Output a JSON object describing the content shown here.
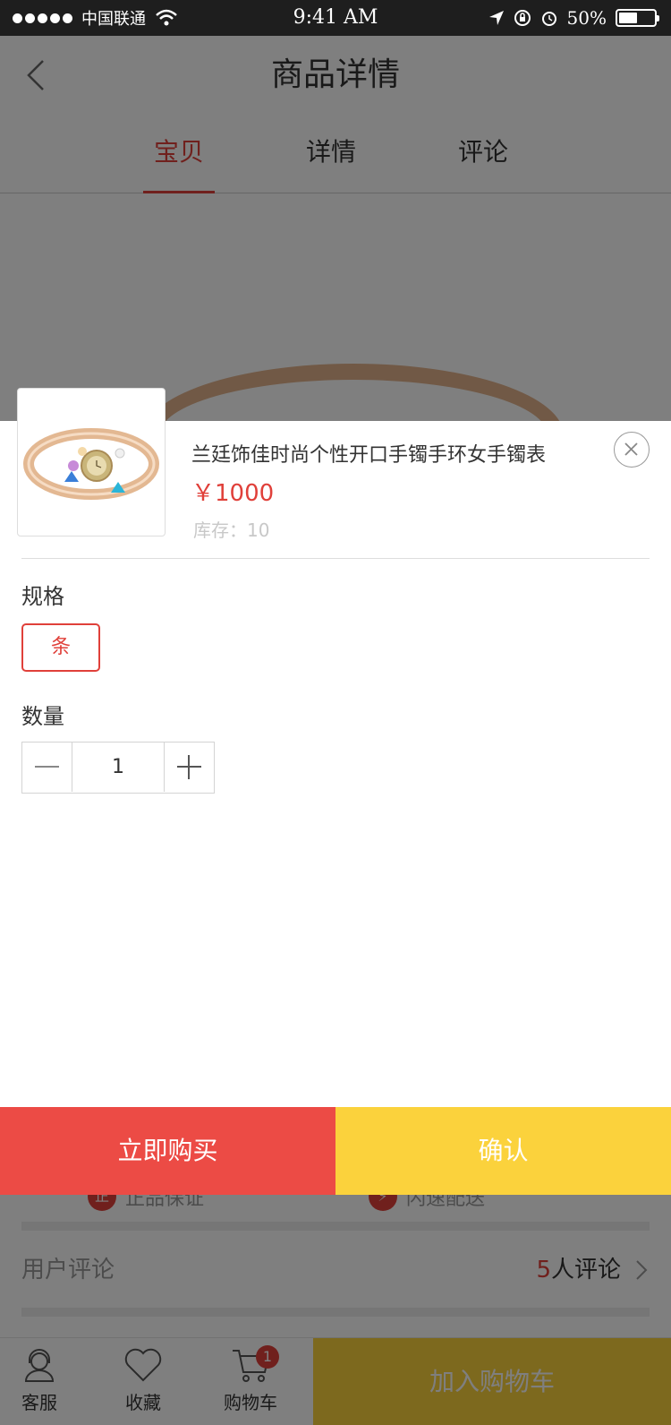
{
  "status_bar": {
    "carrier": "中国联通",
    "time": "9:41 AM",
    "battery": "50%"
  },
  "nav": {
    "title": "商品详情"
  },
  "tabs": [
    {
      "label": "宝贝"
    },
    {
      "label": "详情"
    },
    {
      "label": "评论"
    }
  ],
  "services": [
    {
      "label": "正品保证"
    },
    {
      "label": "闪速配送"
    }
  ],
  "reviews": {
    "title": "用户评论",
    "count": "5",
    "suffix": "人评论"
  },
  "bottom_bar": {
    "items": [
      {
        "label": "客服"
      },
      {
        "label": "收藏"
      },
      {
        "label": "购物车"
      }
    ],
    "cart_badge": "1",
    "add_to_cart": "加入购物车"
  },
  "sheet": {
    "product_name": "兰廷饰佳时尚个性开口手镯手环女手镯表",
    "price": "￥1000",
    "stock": "库存：10",
    "spec_label": "规格",
    "spec_option": "条",
    "quantity_label": "数量",
    "quantity": "1",
    "buy_now": "立即购买",
    "confirm": "确认"
  },
  "colors": {
    "accent": "#e0403a",
    "buy_now": "#ec4b45",
    "confirm": "#fbd23c"
  }
}
